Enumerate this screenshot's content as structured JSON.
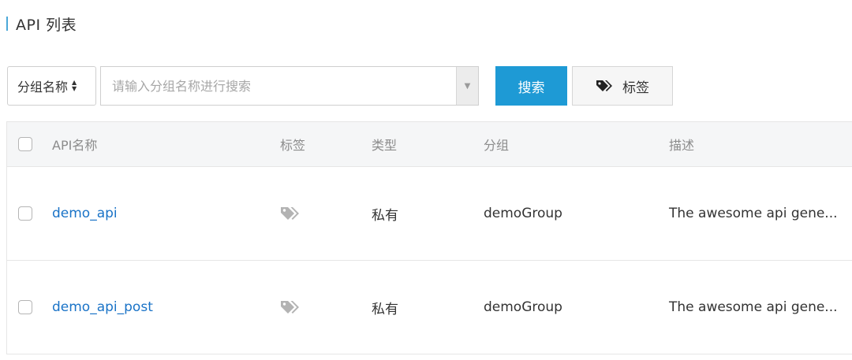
{
  "page": {
    "title": "API 列表"
  },
  "toolbar": {
    "group_select_label": "分组名称",
    "search_placeholder": "请输入分组名称进行搜索",
    "search_value": "",
    "search_button_label": "搜索",
    "tag_button_label": "标签"
  },
  "icons": {
    "sort": "sort-arrows-icon",
    "dropdown": "chevron-down-icon",
    "tag": "tag-icon"
  },
  "colors": {
    "accent": "#4ba8d8",
    "primary_button": "#1e9ad5",
    "link": "#1a73c7",
    "header_bg": "#f5f6f7"
  },
  "table": {
    "columns": [
      "API名称",
      "标签",
      "类型",
      "分组",
      "描述"
    ],
    "rows": [
      {
        "name": "demo_api",
        "type": "私有",
        "group": "demoGroup",
        "description": "The awesome api gene..."
      },
      {
        "name": "demo_api_post",
        "type": "私有",
        "group": "demoGroup",
        "description": "The awesome api gene..."
      }
    ]
  }
}
